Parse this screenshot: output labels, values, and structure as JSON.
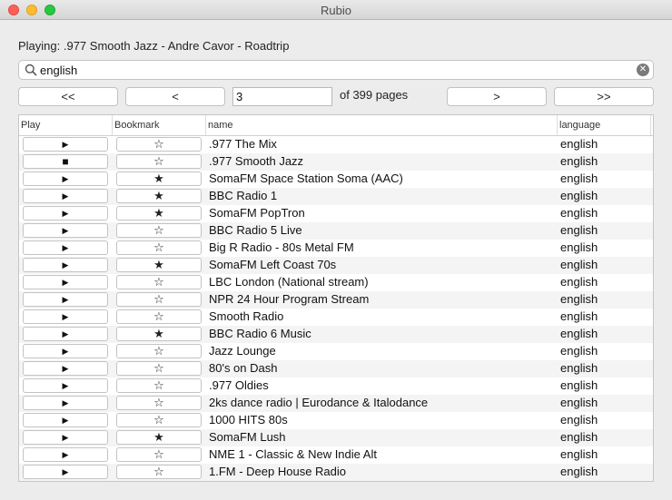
{
  "window": {
    "title": "Rubio"
  },
  "now_playing": "Playing: .977 Smooth Jazz - Andre Cavor - Roadtrip",
  "search": {
    "value": "english"
  },
  "pagination": {
    "first_label": "<<",
    "prev_label": "<",
    "page_value": "3",
    "of_pages_label": "of 399 pages",
    "next_label": ">",
    "last_label": ">>"
  },
  "table": {
    "columns": [
      "Play",
      "Bookmark",
      "name",
      "language"
    ],
    "rows": [
      {
        "playing": false,
        "bookmarked": false,
        "name": ".977 The Mix",
        "language": "english"
      },
      {
        "playing": true,
        "bookmarked": false,
        "name": ".977 Smooth Jazz",
        "language": "english"
      },
      {
        "playing": false,
        "bookmarked": true,
        "name": "SomaFM Space Station Soma (AAC)",
        "language": "english"
      },
      {
        "playing": false,
        "bookmarked": true,
        "name": "BBC Radio 1",
        "language": "english"
      },
      {
        "playing": false,
        "bookmarked": true,
        "name": "SomaFM PopTron",
        "language": "english"
      },
      {
        "playing": false,
        "bookmarked": false,
        "name": "BBC Radio 5 Live",
        "language": "english"
      },
      {
        "playing": false,
        "bookmarked": false,
        "name": "Big R Radio - 80s Metal FM",
        "language": "english"
      },
      {
        "playing": false,
        "bookmarked": true,
        "name": "SomaFM Left Coast 70s",
        "language": "english"
      },
      {
        "playing": false,
        "bookmarked": false,
        "name": "LBC London (National stream)",
        "language": "english"
      },
      {
        "playing": false,
        "bookmarked": false,
        "name": "NPR 24 Hour Program Stream",
        "language": "english"
      },
      {
        "playing": false,
        "bookmarked": false,
        "name": "Smooth Radio",
        "language": "english"
      },
      {
        "playing": false,
        "bookmarked": true,
        "name": "BBC Radio 6 Music",
        "language": "english"
      },
      {
        "playing": false,
        "bookmarked": false,
        "name": "Jazz Lounge",
        "language": "english"
      },
      {
        "playing": false,
        "bookmarked": false,
        "name": "80's on Dash",
        "language": "english"
      },
      {
        "playing": false,
        "bookmarked": false,
        "name": ".977 Oldies",
        "language": "english"
      },
      {
        "playing": false,
        "bookmarked": false,
        "name": "2ks dance radio | Eurodance & Italodance",
        "language": "english"
      },
      {
        "playing": false,
        "bookmarked": false,
        "name": "1000 HITS 80s",
        "language": "english"
      },
      {
        "playing": false,
        "bookmarked": true,
        "name": "SomaFM Lush",
        "language": "english"
      },
      {
        "playing": false,
        "bookmarked": false,
        "name": "NME 1 - Classic & New Indie Alt",
        "language": "english"
      },
      {
        "playing": false,
        "bookmarked": false,
        "name": "1.FM - Deep House Radio",
        "language": "english"
      }
    ]
  },
  "icons": {
    "play": "play-icon",
    "stop": "stop-icon",
    "star_filled": "star-filled-icon",
    "star_empty": "star-outline-icon"
  }
}
